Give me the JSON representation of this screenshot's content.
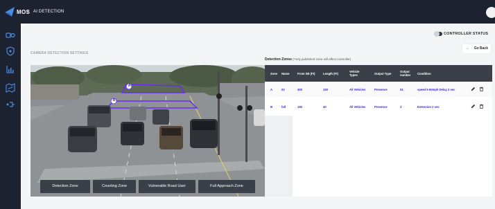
{
  "topbar": {
    "app_name": "MOS",
    "separator": "/",
    "breadcrumb": "AI DETECTION"
  },
  "sidebar": {
    "icons": [
      "camera-tracking-icon",
      "shield-icon",
      "bar-chart-icon",
      "map-route-icon",
      "signal-icon"
    ]
  },
  "header": {
    "controller_status_label": "CONTROLLER STATUS",
    "go_back_label": "Go Back"
  },
  "camera": {
    "title": "CAMERA DETECTION SETTINGS",
    "zone_markers": [
      "A",
      "B"
    ],
    "buttons": [
      "Detection Zone",
      "Counting Zone",
      "Vulnerable Road User",
      "Full Approach Zone"
    ]
  },
  "detection_zones": {
    "title": "Detection Zones",
    "note": "(*only published zone will affect controller)",
    "columns": [
      "Zone",
      "Name",
      "From SB (Ft)",
      "Length (Ft)",
      "Vehicle Types",
      "Output Type",
      "Output number",
      "Condition"
    ],
    "rows": [
      {
        "zone": "A",
        "name": "02",
        "from_sb": "300",
        "length": "150",
        "vehicle_types": "All Vehicles",
        "output_type": "Presence",
        "output_number": "51",
        "condition": "speed 5-60mph Delay 2 sec"
      },
      {
        "zone": "B",
        "name": "fall",
        "from_sb": "150",
        "length": "40",
        "vehicle_types": "All Vehicles",
        "output_type": "Presence",
        "output_number": "3",
        "condition": "Extension 2 sec"
      }
    ]
  },
  "colors": {
    "accent": "#3a22e0",
    "zone_outline": "#6a2df0",
    "dark": "#1c2230"
  }
}
